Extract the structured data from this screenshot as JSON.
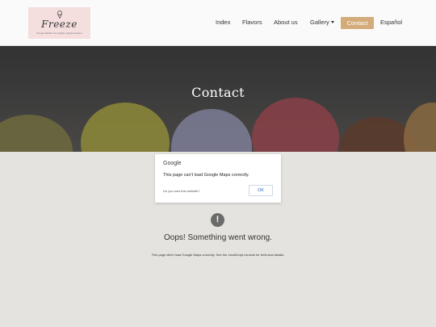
{
  "logo": {
    "brand": "Freeze",
    "tagline": "Ilmega harktan ice pirigala, pirgeloneatonu"
  },
  "nav": {
    "items": [
      "Index",
      "Flavors",
      "About us",
      "Gallery",
      "Contact",
      "Español"
    ],
    "active": "Contact"
  },
  "hero": {
    "title": "Contact"
  },
  "map_error": {
    "dialog_logo": "Google",
    "dialog_message": "This page can't load Google Maps correctly.",
    "dialog_own": "Do you own this website?",
    "dialog_ok": "OK",
    "icon_glyph": "!",
    "headline": "Oops! Something went wrong.",
    "detail": "This page didn't load Google Maps correctly. See the JavaScript console for technical details."
  },
  "colors": {
    "accent": "#d4ac7b",
    "logo_bg": "#f4dede",
    "map_bg": "#e5e3df"
  }
}
